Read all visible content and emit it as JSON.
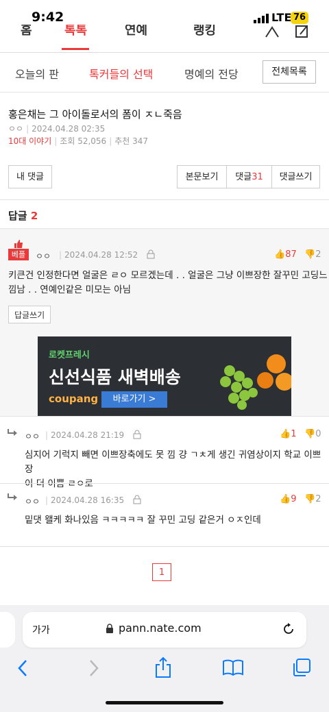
{
  "status": {
    "time": "9:42",
    "network": "LTE",
    "battery": "76"
  },
  "topnav": {
    "items": [
      "홈",
      "톡톡",
      "연예",
      "랭킹"
    ]
  },
  "subtabs": {
    "items": [
      "오늘의 판",
      "톡커들의 선택",
      "명예의 전당"
    ],
    "all_button": "전체목록"
  },
  "article": {
    "title": "홍은채는 그 아이돌로서의 폼이 ㅈㄴ죽음",
    "author": "ㅇㅇ",
    "datetime": "2024.04.28 02:35",
    "category": "10대 이야기",
    "views": "조회 52,056",
    "recommends": "추천 347"
  },
  "actions": {
    "my_comments": "내 댓글",
    "view_body": "본문보기",
    "comments_label": "댓글",
    "comments_count": "31",
    "write_comment": "댓글쓰기"
  },
  "replies_header": {
    "label": "답글",
    "count": "2"
  },
  "best_comment": {
    "badge": "베플",
    "author": "ㅇㅇ",
    "datetime": "2024.04.28 12:52",
    "up": "87",
    "down": "2",
    "text_line1": "키큰건 인정한다면 얼굴은 ㄹㅇ 모르겠는데 . . 얼굴은 그냥 이쁘장한 잘꾸민 고딩느",
    "text_line2": "낌남 . . 연예인같은 미모는 아님",
    "reply_button": "답글쓰기"
  },
  "ad": {
    "rocket": "로켓프레시",
    "headline": "신선식품 새벽배송",
    "brand": "coupang",
    "cta": "바로가기 >"
  },
  "replies": [
    {
      "author": "ㅇㅇ",
      "datetime": "2024.04.28 21:19",
      "up": "1",
      "down": "0",
      "text_line1": "심지어 기럭지 빼면 이쁘장축에도 못 낌 걍 ㄱㅊ게 생긴 귀염상이지 학교 이쁘장",
      "text_line2": "이 더 이쁨 ㄹㅇ로"
    },
    {
      "author": "ㅇㅇ",
      "datetime": "2024.04.28 16:35",
      "up": "9",
      "down": "2",
      "text_line1": "밑댓 왤케 화나있음 ㅋㅋㅋㅋㅋ 잘 꾸민 고딩 같은거 ㅇㅈ인데",
      "text_line2": ""
    }
  ],
  "pagination": {
    "current": "1"
  },
  "browser": {
    "aa": "가가",
    "url": "pann.nate.com"
  },
  "colors": {
    "accent": "#e83a3a",
    "browser_blue": "#0a7aff"
  }
}
